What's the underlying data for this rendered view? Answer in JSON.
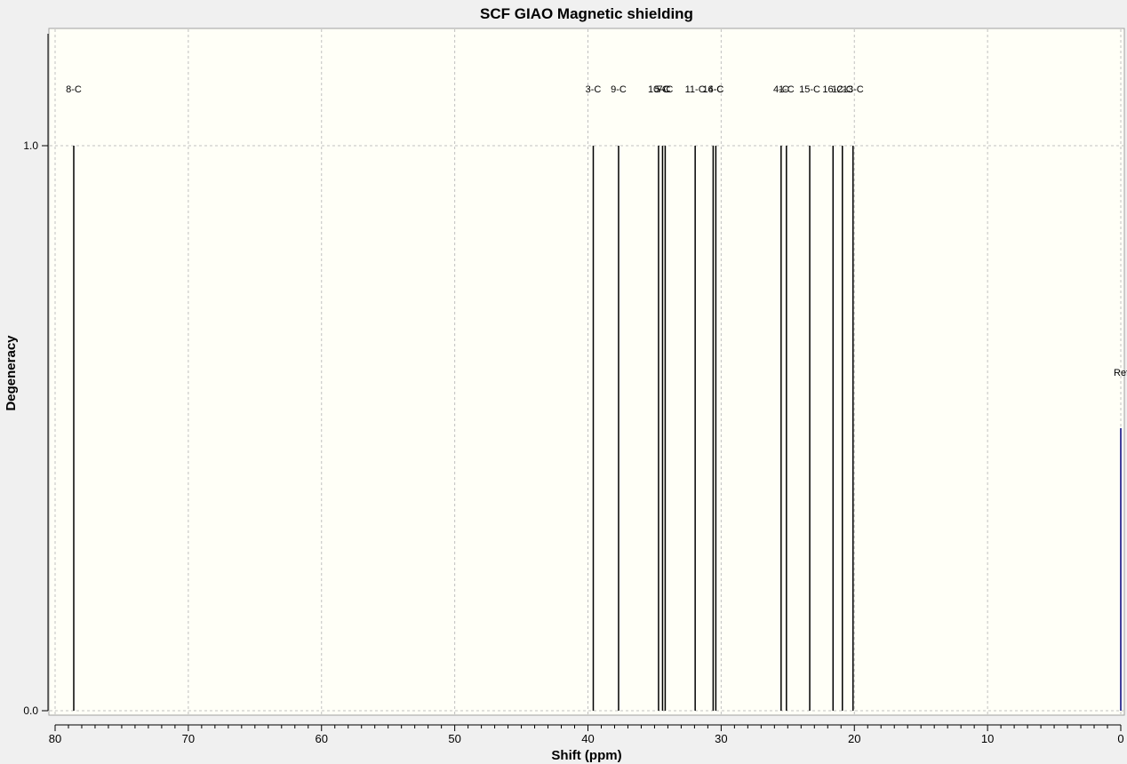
{
  "chart_data": {
    "type": "bar",
    "title": "SCF GIAO Magnetic shielding",
    "xlabel": "Shift (ppm)",
    "ylabel": "Degeneracy",
    "xlim": [
      80,
      0
    ],
    "ylim": [
      0,
      1.21
    ],
    "x_ticks": [
      80,
      70,
      60,
      50,
      40,
      30,
      20,
      10,
      0
    ],
    "y_ticks": [
      "0.0",
      "1.0"
    ],
    "y_tick_values": [
      0,
      1
    ],
    "grid": true,
    "peaks": [
      {
        "label": "8-C",
        "x": 78.6,
        "y": 1
      },
      {
        "label": "3-C",
        "x": 39.6,
        "y": 1
      },
      {
        "label": "9-C",
        "x": 37.7,
        "y": 1
      },
      {
        "label": "10-C",
        "x": 34.7,
        "y": 1
      },
      {
        "label": "5-C",
        "x": 34.4,
        "y": 1
      },
      {
        "label": "7-C",
        "x": 34.2,
        "y": 1
      },
      {
        "label": "11-C",
        "x": 31.95,
        "y": 1
      },
      {
        "label": "14-C",
        "x": 30.6,
        "y": 1
      },
      {
        "label": "6-C",
        "x": 30.4,
        "y": 1
      },
      {
        "label": "4-C",
        "x": 25.5,
        "y": 1
      },
      {
        "label": "1-C",
        "x": 25.1,
        "y": 1
      },
      {
        "label": "15-C",
        "x": 23.35,
        "y": 1
      },
      {
        "label": "16-C",
        "x": 21.6,
        "y": 1
      },
      {
        "label": "12-C",
        "x": 20.9,
        "y": 1
      },
      {
        "label": "13-C",
        "x": 20.1,
        "y": 1
      }
    ],
    "reference": {
      "label": "Ref",
      "x": 0,
      "y": 0.5,
      "color": "#000080"
    },
    "colors": {
      "plot_bg": "#fffff7",
      "page_bg": "#f0f0f0",
      "peak": "#000000",
      "grid": "#c0c0c0"
    }
  }
}
